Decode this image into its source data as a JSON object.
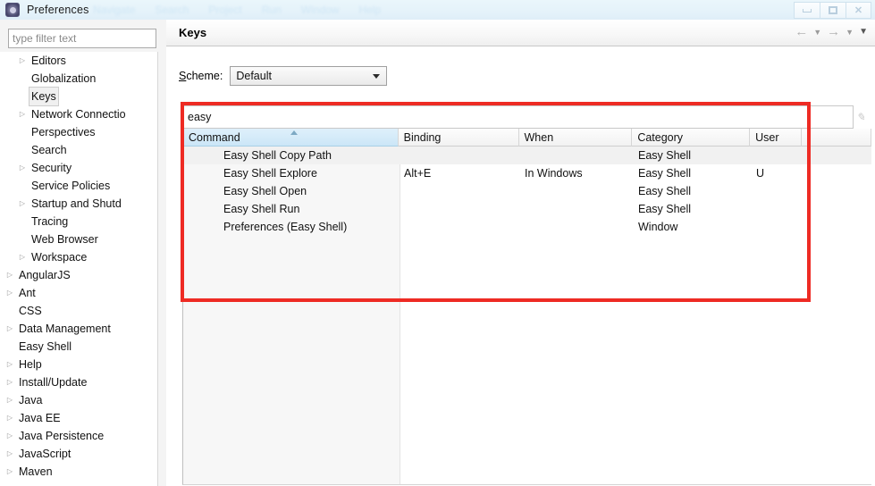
{
  "window": {
    "title": "Preferences",
    "icon": "preferences-icon",
    "background_menu_items": [
      "Navigate",
      "Search",
      "Project",
      "Run",
      "Window",
      "Help"
    ],
    "controls": {
      "minimize": "minimize-button",
      "restore": "restore-button",
      "close": "close-button",
      "close_glyph": "✕"
    }
  },
  "sidebar": {
    "filter": {
      "value": "",
      "placeholder": "type filter text"
    },
    "items": [
      {
        "label": "Editors",
        "expandable": true,
        "indent": 1,
        "selected": false
      },
      {
        "label": "Globalization",
        "expandable": false,
        "indent": 1,
        "selected": false
      },
      {
        "label": "Keys",
        "expandable": false,
        "indent": 1,
        "selected": true
      },
      {
        "label": "Network Connectio",
        "expandable": true,
        "indent": 1,
        "selected": false
      },
      {
        "label": "Perspectives",
        "expandable": false,
        "indent": 1,
        "selected": false
      },
      {
        "label": "Search",
        "expandable": false,
        "indent": 1,
        "selected": false
      },
      {
        "label": "Security",
        "expandable": true,
        "indent": 1,
        "selected": false
      },
      {
        "label": "Service Policies",
        "expandable": false,
        "indent": 1,
        "selected": false
      },
      {
        "label": "Startup and Shutd",
        "expandable": true,
        "indent": 1,
        "selected": false
      },
      {
        "label": "Tracing",
        "expandable": false,
        "indent": 1,
        "selected": false
      },
      {
        "label": "Web Browser",
        "expandable": false,
        "indent": 1,
        "selected": false
      },
      {
        "label": "Workspace",
        "expandable": true,
        "indent": 1,
        "selected": false
      },
      {
        "label": "AngularJS",
        "expandable": true,
        "indent": 0,
        "selected": false
      },
      {
        "label": "Ant",
        "expandable": true,
        "indent": 0,
        "selected": false
      },
      {
        "label": "CSS",
        "expandable": false,
        "indent": 0,
        "selected": false
      },
      {
        "label": "Data Management",
        "expandable": true,
        "indent": 0,
        "selected": false
      },
      {
        "label": "Easy Shell",
        "expandable": false,
        "indent": 0,
        "selected": false
      },
      {
        "label": "Help",
        "expandable": true,
        "indent": 0,
        "selected": false
      },
      {
        "label": "Install/Update",
        "expandable": true,
        "indent": 0,
        "selected": false
      },
      {
        "label": "Java",
        "expandable": true,
        "indent": 0,
        "selected": false
      },
      {
        "label": "Java EE",
        "expandable": true,
        "indent": 0,
        "selected": false
      },
      {
        "label": "Java Persistence",
        "expandable": true,
        "indent": 0,
        "selected": false
      },
      {
        "label": "JavaScript",
        "expandable": true,
        "indent": 0,
        "selected": false
      },
      {
        "label": "Maven",
        "expandable": true,
        "indent": 0,
        "selected": false
      }
    ],
    "expand_glyph": "▷",
    "scroll_up_glyph": "▲"
  },
  "page": {
    "title": "Keys",
    "nav": {
      "back": "←",
      "back_caret": "▼",
      "forward": "→",
      "forward_caret": "▼",
      "menu_caret": "▼"
    },
    "scheme": {
      "label_prefix": "S",
      "label_rest": "cheme:",
      "value": "Default"
    },
    "search": {
      "value": "easy",
      "placeholder": "",
      "clear_icon": "clear-icon"
    },
    "table": {
      "columns": [
        {
          "key": "command",
          "label": "Command",
          "sorted": true
        },
        {
          "key": "binding",
          "label": "Binding",
          "sorted": false
        },
        {
          "key": "when",
          "label": "When",
          "sorted": false
        },
        {
          "key": "category",
          "label": "Category",
          "sorted": false
        },
        {
          "key": "user",
          "label": "User",
          "sorted": false
        }
      ],
      "rows": [
        {
          "command": "Easy Shell Copy Path",
          "binding": "",
          "when": "",
          "category": "Easy Shell",
          "user": "",
          "selected": true
        },
        {
          "command": "Easy Shell Explore",
          "binding": "Alt+E",
          "when": "In Windows",
          "category": "Easy Shell",
          "user": "U",
          "selected": false
        },
        {
          "command": "Easy Shell Open",
          "binding": "",
          "when": "",
          "category": "Easy Shell",
          "user": "",
          "selected": false
        },
        {
          "command": "Easy Shell Run",
          "binding": "",
          "when": "",
          "category": "Easy Shell",
          "user": "",
          "selected": false
        },
        {
          "command": "Preferences (Easy Shell)",
          "binding": "",
          "when": "",
          "category": "Window",
          "user": "",
          "selected": false
        }
      ]
    },
    "highlight": {
      "color": "#ee2b24",
      "name": "red-annotation-box"
    }
  },
  "colors": {
    "accent_blue": "#cbe6f7",
    "annotation_red": "#ee2b24",
    "selection_gray": "#f1f1f1"
  }
}
